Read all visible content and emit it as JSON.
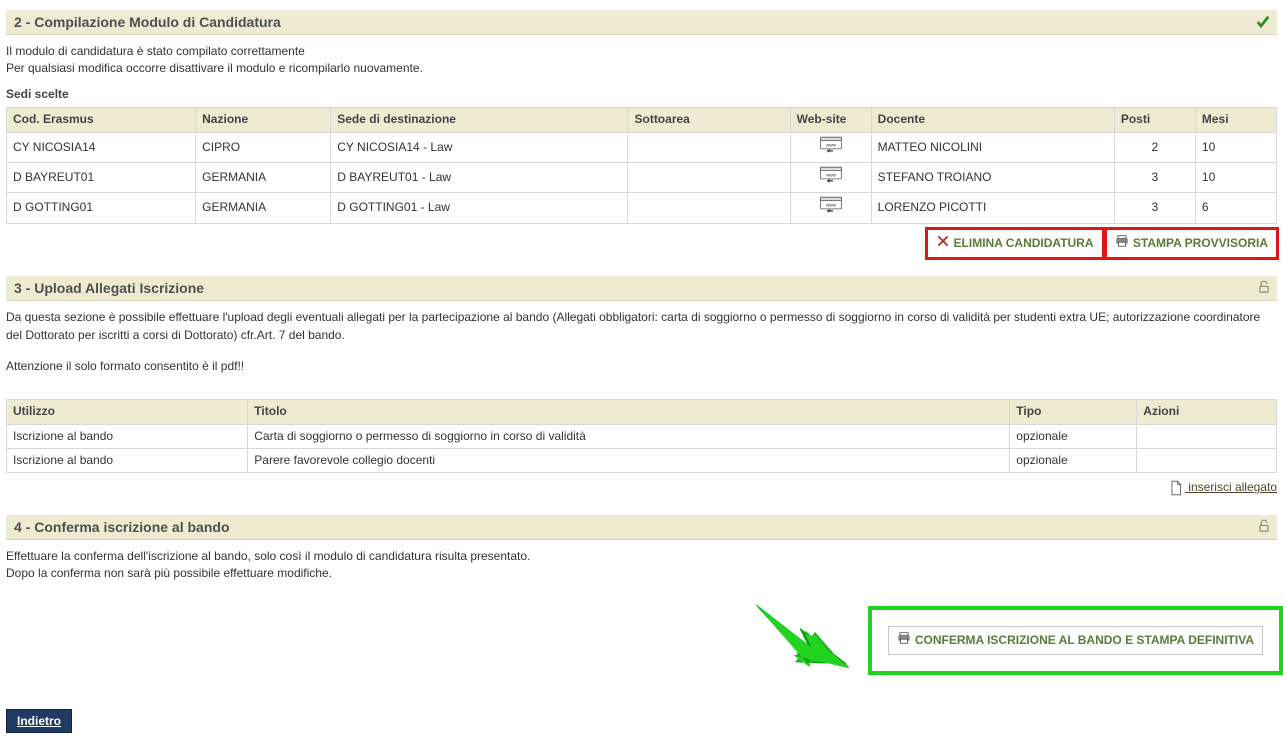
{
  "section2": {
    "title": "2 - Compilazione Modulo di Candidatura",
    "line1": "Il modulo di candidatura è stato compilato correttamente",
    "line2": "Per qualsiasi modifica occorre disattivare il modulo e ricompilarlo nuovamente.",
    "subheading": "Sedi scelte",
    "headers": {
      "cod": "Cod. Erasmus",
      "nazione": "Nazione",
      "sede": "Sede di destinazione",
      "sottoarea": "Sottoarea",
      "web": "Web-site",
      "docente": "Docente",
      "posti": "Posti",
      "mesi": "Mesi"
    },
    "rows": [
      {
        "cod": "CY NICOSIA14",
        "nazione": "CIPRO",
        "sede": "CY NICOSIA14 - Law",
        "sottoarea": "",
        "docente": "MATTEO NICOLINI",
        "posti": "2",
        "mesi": "10"
      },
      {
        "cod": "D BAYREUT01",
        "nazione": "GERMANIA",
        "sede": "D BAYREUT01 - Law",
        "sottoarea": "",
        "docente": "STEFANO TROIANO",
        "posti": "3",
        "mesi": "10"
      },
      {
        "cod": "D GOTTING01",
        "nazione": "GERMANIA",
        "sede": "D GOTTING01 - Law",
        "sottoarea": "",
        "docente": "LORENZO PICOTTI",
        "posti": "3",
        "mesi": "6"
      }
    ],
    "deleteLabel": "ELIMINA CANDIDATURA",
    "printLabel": "STAMPA PROVVISORIA"
  },
  "section3": {
    "title": "3 - Upload Allegati Iscrizione",
    "line1": "Da questa sezione è possibile effettuare l'upload degli eventuali allegati per la partecipazione al bando (Allegati obbligatori: carta di soggiorno o permesso di soggiorno in corso di validità per studenti extra UE; autorizzazione coordinatore del Dottorato per iscritti a corsi di Dottorato) cfr.Art. 7 del bando.",
    "line2": "Attenzione il solo formato consentito è il pdf!!",
    "headers": {
      "utilizzo": "Utilizzo",
      "titolo": "Titolo",
      "tipo": "Tipo",
      "azioni": "Azioni"
    },
    "rows": [
      {
        "utilizzo": "Iscrizione al bando",
        "titolo": "Carta di soggiorno o permesso di soggiorno in corso di validità",
        "tipo": "opzionale"
      },
      {
        "utilizzo": "Iscrizione al bando",
        "titolo": "Parere favorevole collegio docenti",
        "tipo": "opzionale"
      }
    ],
    "insertLink": "inserisci allegato"
  },
  "section4": {
    "title": "4 - Conferma iscrizione al bando",
    "line1": "Effettuare la conferma dell'iscrizione al bando, solo così il modulo di candidatura risulta presentato.",
    "line2": "Dopo la conferma non sarà più possibile effettuare modifiche.",
    "confirmLabel": "CONFERMA ISCRIZIONE AL BANDO E STAMPA DEFINITIVA"
  },
  "backLabel": "Indietro"
}
